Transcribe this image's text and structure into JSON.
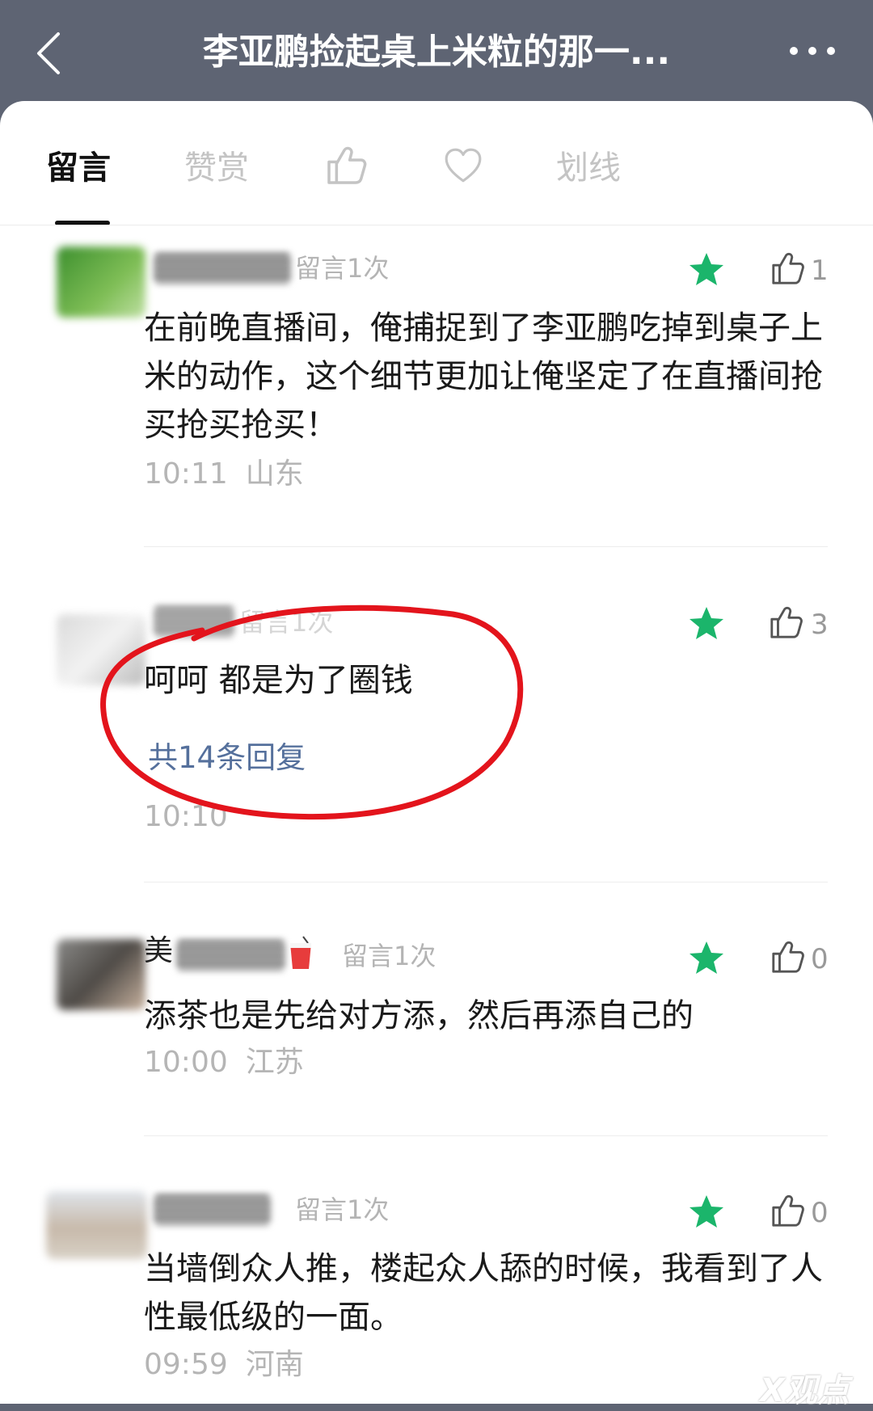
{
  "header": {
    "title": "李亚鹏捡起桌上米粒的那一..."
  },
  "tabs": {
    "comments": "留言",
    "reward": "赞赏",
    "underline": "划线"
  },
  "comments": [
    {
      "count_label": "留言1次",
      "text": "在前晚直播间，俺捕捉到了李亚鹏吃掉到桌子上米的动作，这个细节更加让俺坚定了在直播间抢买抢买抢买！",
      "time": "10:11",
      "location": "山东",
      "likes": "1"
    },
    {
      "count_label": "留言1次",
      "text": "呵呵 都是为了圈钱",
      "replies": "共14条回复",
      "time": "10:10",
      "likes": "3"
    },
    {
      "nickname_prefix": "美",
      "count_label": "留言1次",
      "text": "添茶也是先给对方添，然后再添自己的",
      "time": "10:00",
      "location": "江苏",
      "likes": "0"
    },
    {
      "count_label": "留言1次",
      "text": "当墙倒众人推，楼起众人舔的时候，我看到了人性最低级的一面。",
      "time": "09:59",
      "location": "河南",
      "likes": "0"
    }
  ],
  "watermark": "X观点",
  "colors": {
    "header_bg": "#5e6473",
    "star_green": "#1bb56b",
    "reply_link": "#55709c",
    "annotation_red": "#e3141c"
  }
}
